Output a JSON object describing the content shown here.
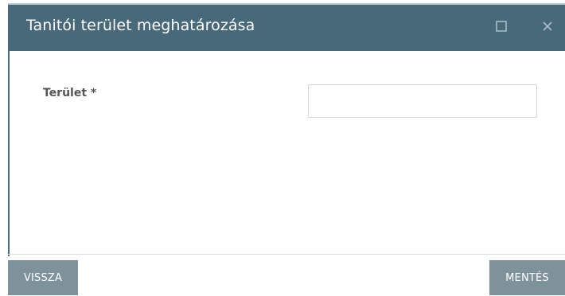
{
  "dialog": {
    "title": "Tanitói terület meghatározása",
    "maximize_icon": "maximize-icon",
    "close_icon": "close-icon"
  },
  "form": {
    "field_label": "Terület *",
    "field_value": "",
    "field_placeholder": ""
  },
  "footer": {
    "back_label": "VISSZA",
    "save_label": "MENTÉS"
  },
  "colors": {
    "title_bar": "#47697a",
    "button": "#7e929c"
  }
}
